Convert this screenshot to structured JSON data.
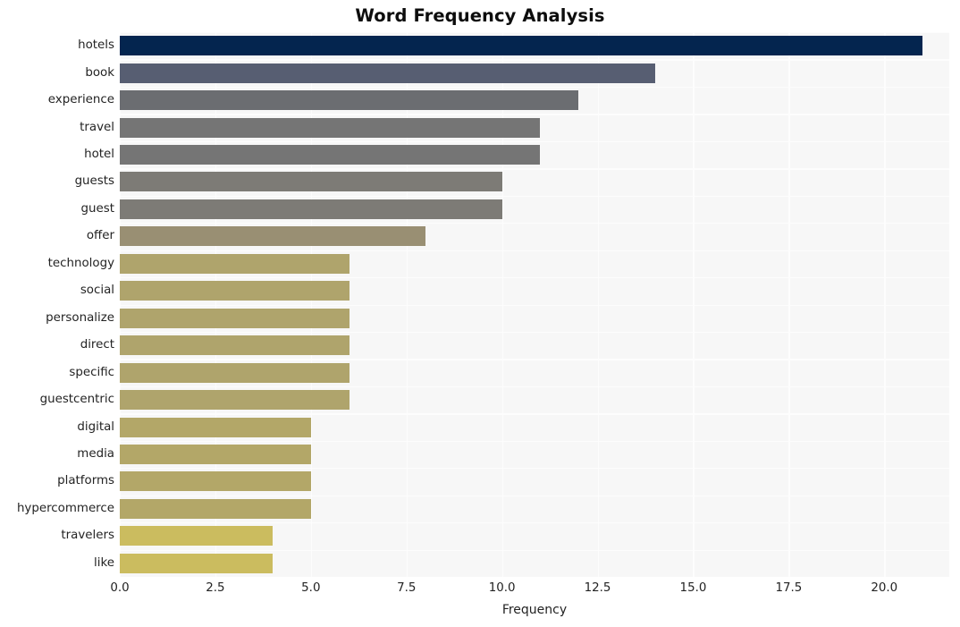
{
  "chart_data": {
    "type": "bar",
    "orientation": "horizontal",
    "title": "Word Frequency Analysis",
    "xlabel": "Frequency",
    "ylabel": "",
    "xlim": [
      0,
      21.7
    ],
    "xticks": [
      0.0,
      2.5,
      5.0,
      7.5,
      10.0,
      12.5,
      15.0,
      17.5,
      20.0
    ],
    "xticklabels": [
      "0.0",
      "2.5",
      "5.0",
      "7.5",
      "10.0",
      "12.5",
      "15.0",
      "17.5",
      "20.0"
    ],
    "grid": true,
    "legend": null,
    "categories": [
      "hotels",
      "book",
      "experience",
      "travel",
      "hotel",
      "guests",
      "guest",
      "offer",
      "technology",
      "social",
      "personalize",
      "direct",
      "specific",
      "guestcentric",
      "digital",
      "media",
      "platforms",
      "hypercommerce",
      "travelers",
      "like"
    ],
    "values": [
      21,
      14,
      12,
      11,
      11,
      10,
      10,
      8,
      6,
      6,
      6,
      6,
      6,
      6,
      5,
      5,
      5,
      5,
      4,
      4
    ],
    "bar_colors": [
      "#04254f",
      "#575e72",
      "#6b6d71",
      "#757575",
      "#757575",
      "#7d7b76",
      "#7d7b76",
      "#998f73",
      "#afa46c",
      "#afa46c",
      "#afa46c",
      "#afa46c",
      "#afa46c",
      "#afa46c",
      "#b3a768",
      "#b3a768",
      "#b3a768",
      "#b3a768",
      "#cbbc5f",
      "#cbbc5f"
    ],
    "plot_background": "#f7f7f7",
    "grid_color": "#fdfdfd"
  }
}
